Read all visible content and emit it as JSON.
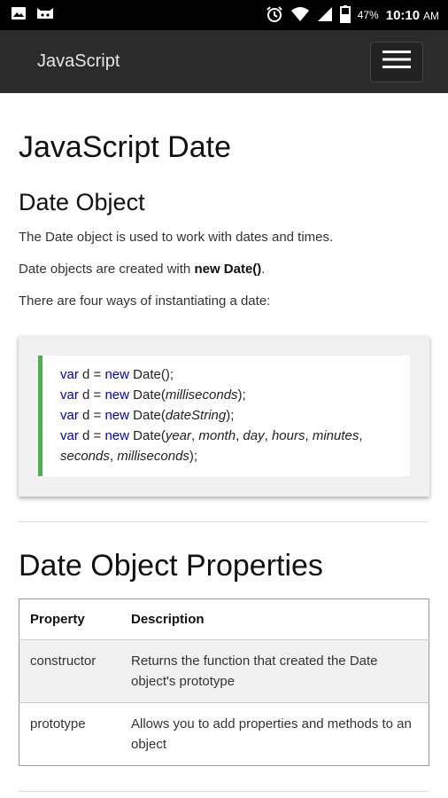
{
  "status_bar": {
    "battery_percent": "47%",
    "time": "10:10",
    "ampm": "AM"
  },
  "nav": {
    "brand": "JavaScript"
  },
  "page": {
    "title": "JavaScript Date",
    "section1": {
      "heading": "Date Object",
      "p1": "The Date object is used to work with dates and times.",
      "p2_before": "Date objects are created with ",
      "p2_bold": "new Date()",
      "p2_after": ".",
      "p3": "There are four ways of instantiating a date:"
    },
    "code_lines": [
      {
        "var": "var",
        "mid": " d = ",
        "new": "new",
        "call": " Date();"
      },
      {
        "var": "var",
        "mid": " d = ",
        "new": "new",
        "call": " Date(",
        "arg": "milliseconds",
        "end": ");"
      },
      {
        "var": "var",
        "mid": " d = ",
        "new": "new",
        "call": " Date(",
        "arg": "dateString",
        "end": ");"
      },
      {
        "var": "var",
        "mid": " d = ",
        "new": "new",
        "call": " Date(",
        "args": [
          "year",
          "month",
          "day",
          "hours",
          "minutes",
          "seconds",
          "milliseconds"
        ],
        "end": ");"
      }
    ],
    "section2": {
      "heading": "Date Object Properties",
      "table": {
        "headers": [
          "Property",
          "Description"
        ],
        "rows": [
          [
            "constructor",
            "Returns the function that created the Date object's prototype"
          ],
          [
            "prototype",
            "Allows you to add properties and methods to an object"
          ]
        ]
      }
    }
  },
  "icons": {
    "status_left": [
      "image-icon",
      "android-cat-icon"
    ],
    "status_right": [
      "alarm-icon",
      "wifi-icon",
      "signal-icon",
      "battery-icon"
    ]
  }
}
